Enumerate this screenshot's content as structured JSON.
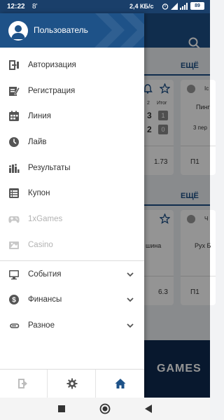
{
  "status_bar": {
    "time": "12:22",
    "notification": "8'",
    "network_speed": "2,4 КБ/с",
    "battery": "89"
  },
  "drawer": {
    "user_name": "Пользователь",
    "menu": [
      {
        "label": "Авторизация",
        "icon": "login-icon",
        "enabled": true
      },
      {
        "label": "Регистрация",
        "icon": "registration-icon",
        "enabled": true
      },
      {
        "label": "Линия",
        "icon": "calendar-icon",
        "enabled": true
      },
      {
        "label": "Лайв",
        "icon": "clock-icon",
        "enabled": true
      },
      {
        "label": "Результаты",
        "icon": "results-bars-icon",
        "enabled": true
      },
      {
        "label": "Купон",
        "icon": "coupon-icon",
        "enabled": true
      },
      {
        "label": "1xGames",
        "icon": "gamepad-icon",
        "enabled": false
      },
      {
        "label": "Casino",
        "icon": "casino-icon",
        "enabled": false
      }
    ],
    "expandable": [
      {
        "label": "События",
        "icon": "monitor-icon"
      },
      {
        "label": "Финансы",
        "icon": "dollar-icon"
      },
      {
        "label": "Разное",
        "icon": "paperclip-icon"
      }
    ]
  },
  "background": {
    "more_label_1": "ЕЩЁ",
    "more_label_2": "ЕЩЁ",
    "card1": {
      "col1": "2",
      "col2": "Итог",
      "score_a": "3",
      "score_b": "2",
      "total_a": "1",
      "total_b": "0",
      "odd": "1.73",
      "side_title": "Ic",
      "side_name": "Пинг",
      "side_period": "3 пер",
      "side_bet": "П1"
    },
    "card2": {
      "team": "шина",
      "odd": "6.3",
      "side_title": "Ч",
      "side_name": "Рух Б",
      "side_bet": "П1"
    },
    "games_label": "GAMES"
  },
  "colors": {
    "primary": "#1e5288",
    "text": "#333333",
    "disabled": "#b3b3b3"
  }
}
